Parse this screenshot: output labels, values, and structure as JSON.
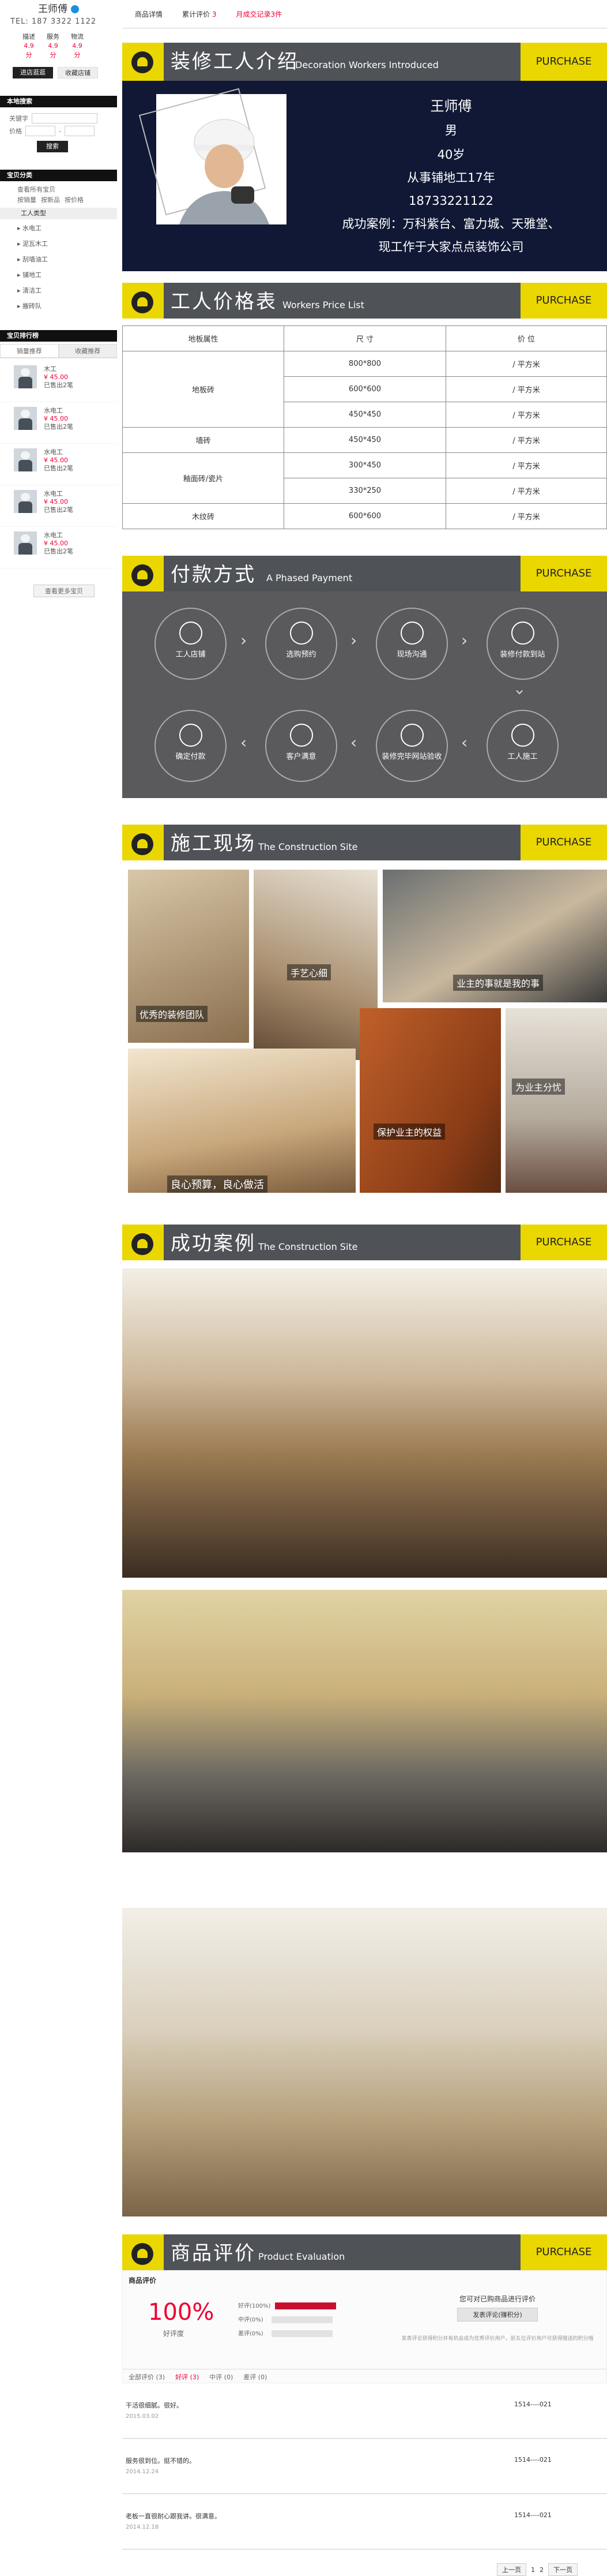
{
  "shop": {
    "name": "王师傅",
    "tel": "TEL: 187 3322 1122",
    "ratings": [
      {
        "label": "描述",
        "value": "4.9分"
      },
      {
        "label": "服务",
        "value": "4.9分"
      },
      {
        "label": "物流",
        "value": "4.9分"
      }
    ],
    "enter_btn": "进店逛逛",
    "fav_btn": "收藏店铺"
  },
  "search": {
    "title": "本地搜索",
    "keyword_label": "关键字",
    "price_label": "价格",
    "dash": "-",
    "btn": "搜索"
  },
  "category": {
    "title": "宝贝分类",
    "all": "查看所有宝贝",
    "sort": [
      "按销量",
      "按新品",
      "按价格"
    ],
    "main": "工人类型",
    "items": [
      "水电工",
      "泥瓦木工",
      "刮墙油工",
      "铺地工",
      "清洁工",
      "搬砖队"
    ]
  },
  "ranking": {
    "title": "宝贝排行榜",
    "tabs": [
      "销量推荐",
      "收藏推荐"
    ],
    "products": [
      {
        "name": "木工",
        "price": "¥ 45.00",
        "sold": "已售出2笔"
      },
      {
        "name": "水电工",
        "price": "¥ 45.00",
        "sold": "已售出2笔"
      },
      {
        "name": "水电工",
        "price": "¥ 45.00",
        "sold": "已售出2笔"
      },
      {
        "name": "水电工",
        "price": "¥ 45.00",
        "sold": "已售出2笔"
      },
      {
        "name": "水电工",
        "price": "¥ 45.00",
        "sold": "已售出2笔"
      }
    ],
    "see_more": "查看更多宝贝"
  },
  "nav": {
    "detail": "商品详情",
    "reviews_prefix": "累计评价",
    "reviews_count": "3",
    "deals": "月成交记录3件"
  },
  "sections": {
    "intro": {
      "cn": "装修工人介绍",
      "en": "Decoration Workers Introduced",
      "purchase": "PURCHASE"
    },
    "price": {
      "cn": "工人价格表",
      "en": "Workers Price List",
      "purchase": "PURCHASE"
    },
    "pay": {
      "cn": "付款方式",
      "en": "A Phased Payment",
      "purchase": "PURCHASE"
    },
    "site": {
      "cn": "施工现场",
      "en": "The Construction Site",
      "purchase": "PURCHASE"
    },
    "cases": {
      "cn": "成功案例",
      "en": "The Construction Site",
      "purchase": "PURCHASE"
    },
    "eval": {
      "cn": "商品评价",
      "en": "Product Evaluation",
      "purchase": "PURCHASE"
    }
  },
  "worker": {
    "name": "王师傅",
    "gender": "男",
    "age": "40岁",
    "experience": "从事铺地工17年",
    "phone": "18733221122",
    "cases_line1": "成功案例：万科紫台、富力城、天雅堂、",
    "cases_line2": "现工作于大家点点装饰公司"
  },
  "price_table": {
    "headers": [
      "地板属性",
      "尺 寸",
      "价 位"
    ],
    "rows": [
      {
        "type": "地板砖",
        "size": "800*800",
        "price": "/ 平方米"
      },
      {
        "type": "",
        "size": "600*600",
        "price": "/ 平方米"
      },
      {
        "type": "",
        "size": "450*450",
        "price": "/ 平方米"
      },
      {
        "type": "墙砖",
        "size": "450*450",
        "price": "/ 平方米"
      },
      {
        "type": "釉面砖/瓷片",
        "size": "300*450",
        "price": "/ 平方米"
      },
      {
        "type": "",
        "size": "330*250",
        "price": "/ 平方米"
      },
      {
        "type": "木纹砖",
        "size": "600*600",
        "price": "/ 平方米"
      }
    ]
  },
  "pay_steps": {
    "top": [
      "工人店铺",
      "选购预约",
      "现场沟通",
      "装修付款到站"
    ],
    "top4b": "站",
    "bottom": [
      "确定付款",
      "客户满意",
      "装修完毕网站验收",
      "工人施工"
    ]
  },
  "site_captions": [
    "手艺心细",
    "业主的事就是我的事",
    "优秀的装修团队",
    "为业主分忧",
    "保护业主的权益",
    "良心预算，良心做活"
  ],
  "eval": {
    "title": "商品评价",
    "score": "100%",
    "score_label": "好评度",
    "bars": [
      {
        "label": "好评",
        "pct": "(100%)"
      },
      {
        "label": "中评",
        "pct": "(0%)"
      },
      {
        "label": "差评",
        "pct": "(0%)"
      }
    ],
    "prompt": "您可对已购商品进行评价",
    "btn": "发表评论(赚积分)",
    "note": "发表评论获得积分并有机会成为优秀评价用户，前五位评价用户可获得赠送的积分哦",
    "filters": {
      "all": "全部评价 (3)",
      "good": "好评 (3)",
      "mid": "中评 (0)",
      "bad": "差评 (0)"
    },
    "reviews": [
      {
        "text": "干活很细腻。很好。",
        "date": "2015.03.02",
        "user": "1514----021"
      },
      {
        "text": "服务很到位。挺不错的。",
        "date": "2014.12.24",
        "user": "1514----021"
      },
      {
        "text": "老板一直很耐心跟我讲。很满意。",
        "date": "2014.12.18",
        "user": "1514----021"
      }
    ],
    "pager": {
      "prev": "上一页",
      "p1": "1",
      "p2": "2",
      "next": "下一页"
    }
  },
  "colors": {
    "yellow": "#ead700",
    "dark": "#4f5257",
    "navy": "#101835",
    "red": "#e03"
  }
}
